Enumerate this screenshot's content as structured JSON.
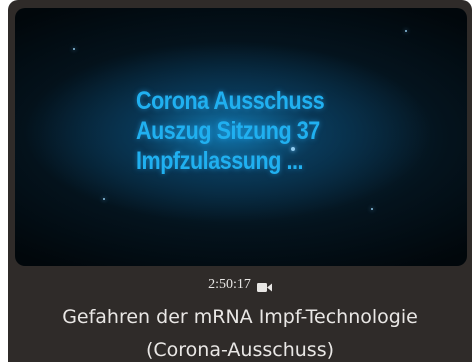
{
  "video_card": {
    "thumbnail_text": [
      "Corona Ausschuss",
      "Auszug Sitzung 37",
      "Impfzulassung ..."
    ],
    "duration": "2:50:17",
    "duration_icon": "video-camera-icon",
    "title_line1": "Gefahren der mRNA Impf-Technologie",
    "title_line2": "(Corona-Ausschuss)"
  },
  "colors": {
    "card_background": "#2f2b29",
    "thumbnail_text": "#20b0f0",
    "title_text": "#e9e7e5"
  }
}
